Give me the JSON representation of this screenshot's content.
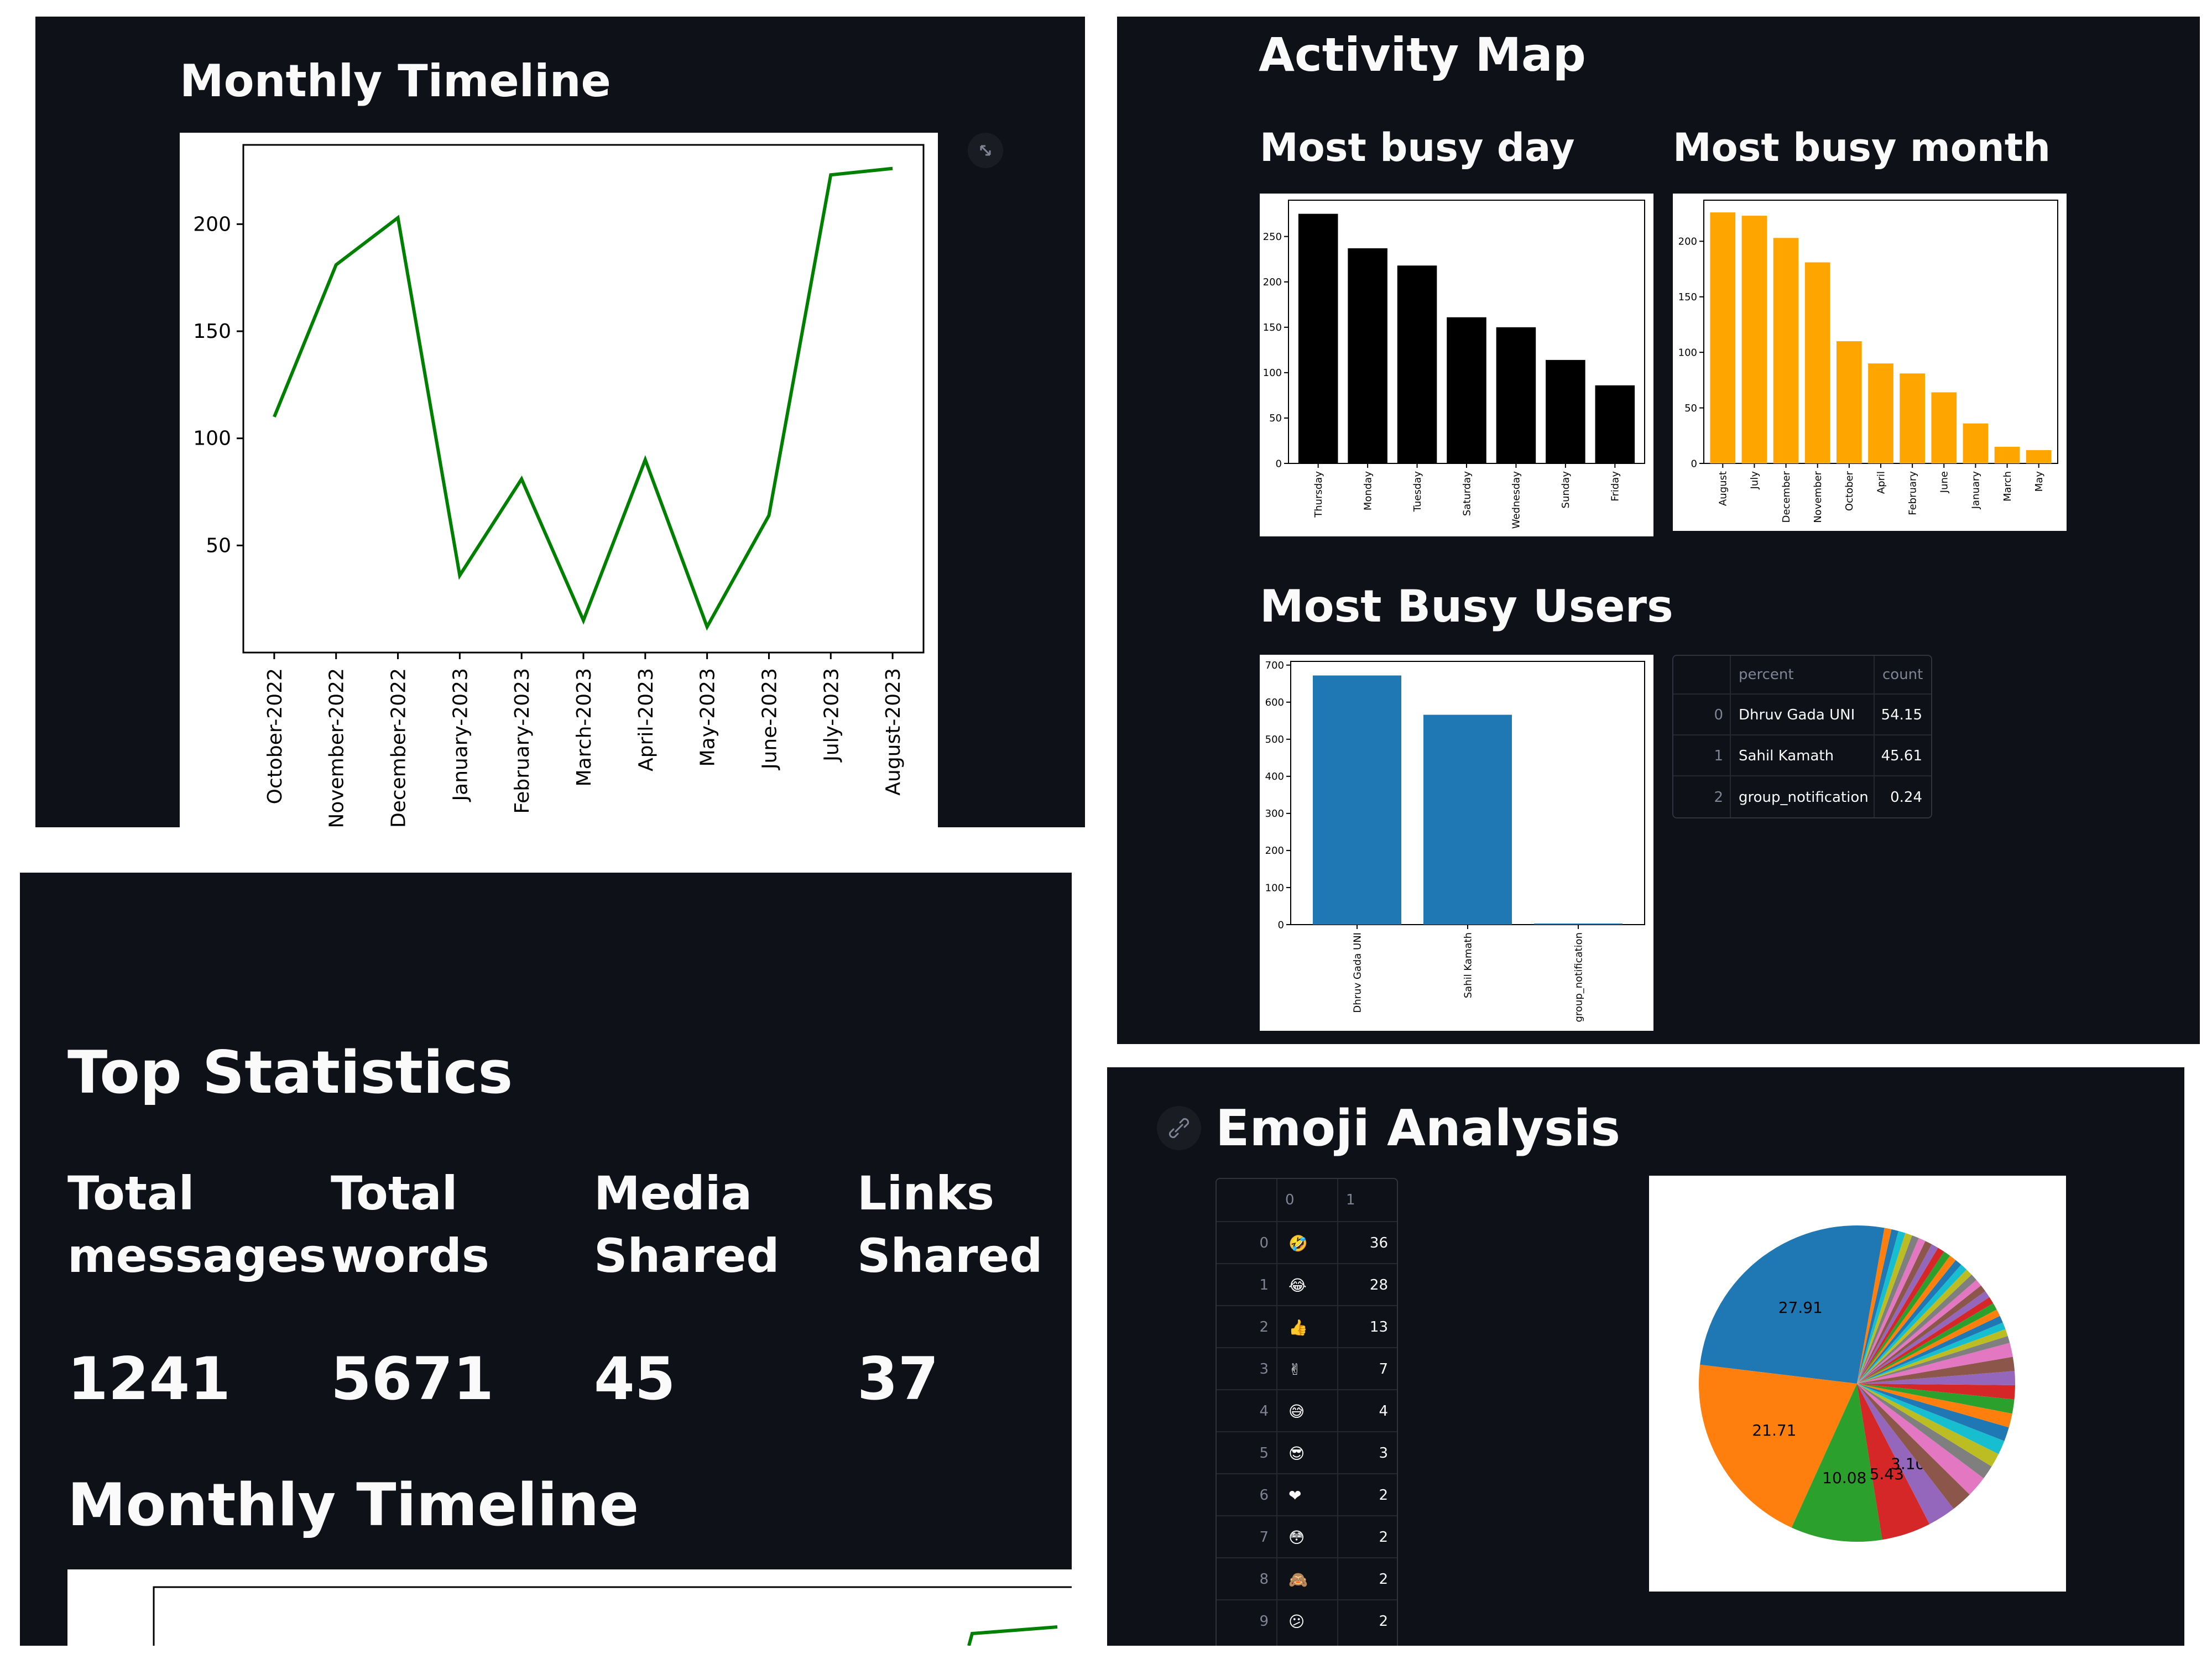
{
  "colors": {
    "app_bg": "#0e1117",
    "text": "#fafafa",
    "line": "#008000",
    "day_bars": "#000000",
    "month_bars": "#ffa500",
    "user_bars": "#1f77b4"
  },
  "timeline_panel": {
    "title": "Monthly Timeline",
    "expand_icon": "fullscreen-expand-icon",
    "chart_data": {
      "type": "line",
      "title": "",
      "xlabel": "",
      "ylabel": "",
      "x": [
        "October-2022",
        "November-2022",
        "December-2022",
        "January-2023",
        "February-2023",
        "March-2023",
        "April-2023",
        "May-2023",
        "June-2023",
        "July-2023",
        "August-2023"
      ],
      "series": [
        {
          "values": [
            110,
            181,
            203,
            36,
            81,
            15,
            90,
            12,
            64,
            223,
            226
          ]
        }
      ],
      "yticks": [
        50,
        100,
        150,
        200
      ],
      "ylim": [
        0,
        237
      ],
      "grid": false,
      "color": "#008000"
    }
  },
  "activity_panel": {
    "title": "Activity Map",
    "busy_day": {
      "title": "Most busy day",
      "chart_data": {
        "type": "bar",
        "categories": [
          "Thursday",
          "Monday",
          "Tuesday",
          "Saturday",
          "Wednesday",
          "Sunday",
          "Friday"
        ],
        "values": [
          275,
          237,
          218,
          161,
          150,
          114,
          86
        ],
        "yticks": [
          0,
          50,
          100,
          150,
          200,
          250
        ],
        "ylim": [
          0,
          290
        ],
        "color": "#000000"
      }
    },
    "busy_month": {
      "title": "Most busy month",
      "chart_data": {
        "type": "bar",
        "categories": [
          "August",
          "July",
          "December",
          "November",
          "October",
          "April",
          "February",
          "June",
          "January",
          "March",
          "May"
        ],
        "values": [
          226,
          223,
          203,
          181,
          110,
          90,
          81,
          64,
          36,
          15,
          12
        ],
        "yticks": [
          0,
          50,
          100,
          150,
          200
        ],
        "ylim": [
          0,
          237
        ],
        "color": "#ffa500"
      }
    },
    "busy_users_title": "Most Busy Users",
    "busy_users": {
      "chart_data": {
        "type": "bar",
        "categories": [
          "Dhruv Gada UNI",
          "Sahil Kamath",
          "group_notification"
        ],
        "values": [
          672,
          566,
          3
        ],
        "yticks": [
          0,
          100,
          200,
          300,
          400,
          500,
          600,
          700
        ],
        "ylim": [
          0,
          710
        ],
        "color": "#1f77b4"
      }
    },
    "users_table": {
      "columns": [
        "percent",
        "count"
      ],
      "rows": [
        {
          "index": "0",
          "name": "Dhruv Gada UNI",
          "value": "54.15"
        },
        {
          "index": "1",
          "name": "Sahil Kamath",
          "value": "45.61"
        },
        {
          "index": "2",
          "name": "group_notification",
          "value": "0.24"
        }
      ]
    }
  },
  "stats_panel": {
    "title": "Top Statistics",
    "stats": [
      {
        "label_1": "Total",
        "label_2": "messages",
        "value": "1241"
      },
      {
        "label_1": "Total",
        "label_2": "words",
        "value": "5671"
      },
      {
        "label_1": "Media",
        "label_2": "Shared",
        "value": "45"
      },
      {
        "label_1": "Links",
        "label_2": "Shared",
        "value": "37"
      }
    ],
    "timeline_title": "Monthly Timeline"
  },
  "emoji_panel": {
    "title": "Emoji Analysis",
    "link_icon": "link-icon",
    "table": {
      "columns": [
        "0",
        "1"
      ],
      "rows": [
        {
          "index": "0",
          "emoji": "🤣",
          "count": "36"
        },
        {
          "index": "1",
          "emoji": "😂",
          "count": "28"
        },
        {
          "index": "2",
          "emoji": "👍",
          "count": "13"
        },
        {
          "index": "3",
          "emoji": "✌",
          "count": "7"
        },
        {
          "index": "4",
          "emoji": "😅",
          "count": "4"
        },
        {
          "index": "5",
          "emoji": "😎",
          "count": "3"
        },
        {
          "index": "6",
          "emoji": "❤",
          "count": "2"
        },
        {
          "index": "7",
          "emoji": "😳",
          "count": "2"
        },
        {
          "index": "8",
          "emoji": "🙈",
          "count": "2"
        },
        {
          "index": "9",
          "emoji": "😕",
          "count": "2"
        }
      ]
    },
    "pie": {
      "chart_data": {
        "type": "pie",
        "values": [
          27.91,
          21.71,
          10.08,
          5.43,
          3.1,
          2.33,
          2.33,
          1.55,
          1.55,
          1.55,
          1.55,
          1.55,
          1.55,
          1.55,
          1.55,
          1.55,
          1.55,
          0.78,
          0.78,
          0.78,
          0.78,
          0.78,
          0.78,
          0.78,
          0.78,
          0.78,
          0.78,
          0.78,
          0.78,
          0.78,
          0.78,
          0.78,
          0.78,
          0.78,
          0.78,
          0.78,
          0.78,
          0.78,
          0.78,
          0.78,
          0.78,
          0.78
        ],
        "labels_shown": [
          "27.91",
          "21.71",
          "10.08",
          "5.43",
          "3.10"
        ],
        "colors": [
          "#1f77b4",
          "#ff7f0e",
          "#2ca02c",
          "#d62728",
          "#9467bd",
          "#8c564b",
          "#e377c2",
          "#7f7f7f",
          "#bcbd22",
          "#17becf"
        ]
      }
    }
  }
}
